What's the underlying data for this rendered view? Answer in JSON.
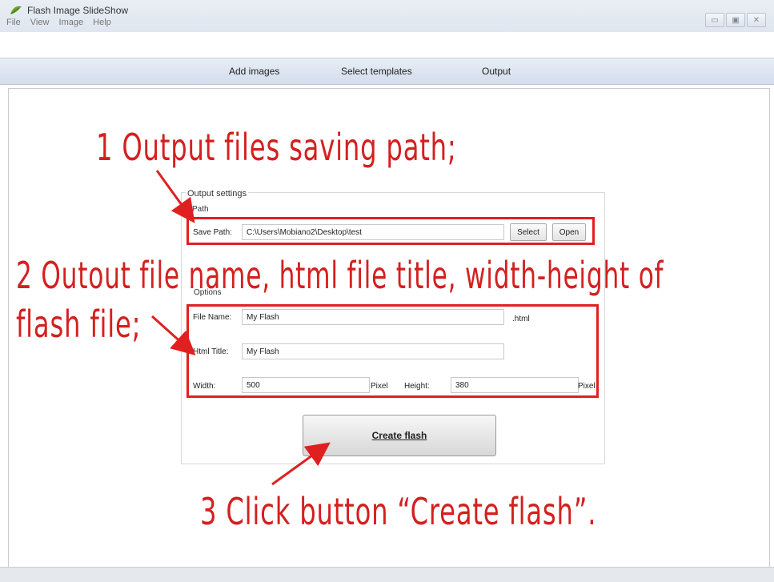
{
  "window": {
    "title": "Flash Image SlideShow",
    "menu": [
      "File",
      "View",
      "Image",
      "Help"
    ],
    "controls": [
      "▭",
      "▣",
      "✕"
    ]
  },
  "toolbar": {
    "add_images": "Add images",
    "select_templates": "Select templates",
    "output": "Output"
  },
  "output_settings": {
    "legend": "Output settings",
    "path_legend": "Path",
    "save_path_label": "Save Path:",
    "save_path_value": "C:\\Users\\Mobiano2\\Desktop\\test",
    "select_label": "Select",
    "open_label": "Open"
  },
  "options": {
    "legend": "Options",
    "file_name_label": "File Name:",
    "file_name_value": "My Flash",
    "file_ext": ".html",
    "html_title_label": "Html Title:",
    "html_title_value": "My Flash",
    "width_label": "Width:",
    "width_value": "500",
    "width_unit": "Pixel",
    "height_label": "Height:",
    "height_value": "380",
    "height_unit": "Pixel"
  },
  "create_button_label": "Create flash",
  "annotations": {
    "step1": "1 Output files saving path;",
    "step2_line1": "2 Outout file name, html file title, width-height of",
    "step2_line2": "flash file;",
    "step3": "3 Click button “Create flash”."
  },
  "colors": {
    "annotation": "#d42020",
    "toolbar_bg": "#dbe4f0"
  }
}
